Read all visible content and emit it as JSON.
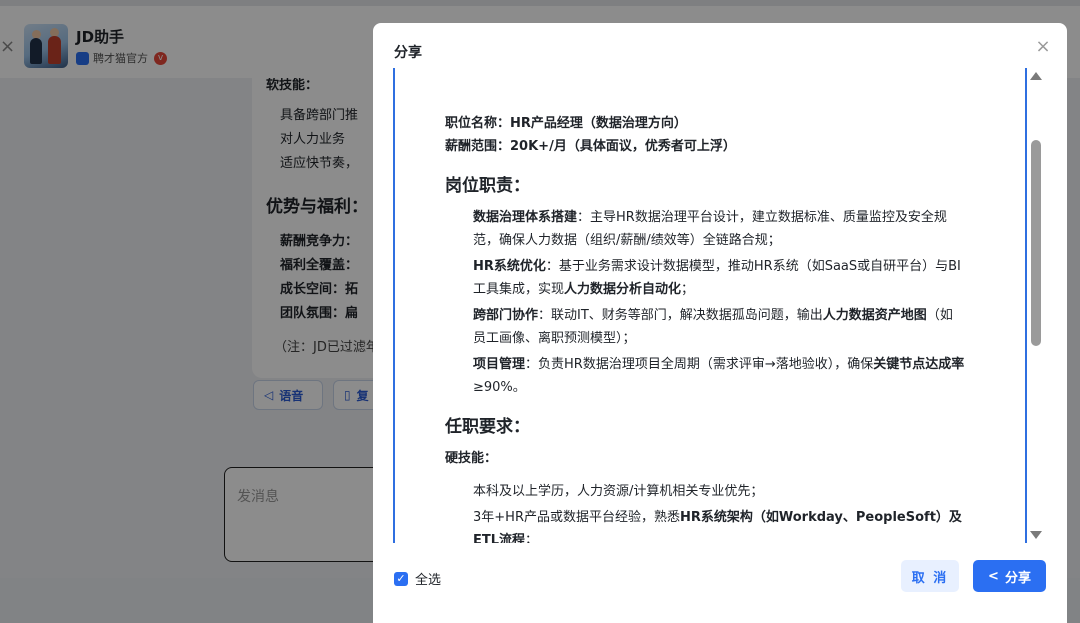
{
  "app": {
    "title": "JD助手",
    "subtitle": "聘才猫官方",
    "close_glyph": "×"
  },
  "background_chat": {
    "lines": [
      {
        "text": "软技能：",
        "style": "b"
      },
      {
        "text": "具备跨部门推",
        "style": ""
      },
      {
        "text": "对人力业务",
        "style": ""
      },
      {
        "text": "适应快节奏，",
        "style": ""
      },
      {
        "text": "优势与福利：",
        "style": "h"
      },
      {
        "text": "薪酬竞争力：",
        "style": "b"
      },
      {
        "text": "福利全覆盖：",
        "style": "b"
      },
      {
        "text": "成长空间：拓",
        "style": "b"
      },
      {
        "text": "团队氛围：扁",
        "style": "b"
      },
      {
        "text": "（注：JD已过滤年",
        "style": ""
      }
    ],
    "voice_button": "语音",
    "copy_button": "复",
    "input_placeholder": "发消息"
  },
  "modal": {
    "title": "分享",
    "close_glyph": "×",
    "content": {
      "position_line": {
        "label": "职位名称：",
        "value": "HR产品经理（数据治理方向）"
      },
      "salary_line": {
        "label": "薪酬范围：",
        "value": "20K+/月（具体面议，优秀者可上浮）"
      },
      "responsibilities_heading": "岗位职责：",
      "responsibilities": [
        {
          "key": "数据治理体系搭建",
          "text": "：主导HR数据治理平台设计，建立数据标准、质量监控及安全规范，确保人力数据（组织/薪酬/绩效等）全链路合规；",
          "bold_tail": "",
          "tail": ""
        },
        {
          "key": "HR系统优化",
          "text": "：基于业务需求设计数据模型，推动HR系统（如SaaS或自研平台）与BI工具集成，实现",
          "bold_tail": "人力数据分析自动化",
          "tail": "；"
        },
        {
          "key": "跨部门协作",
          "text": "：联动IT、财务等部门，解决数据孤岛问题，输出",
          "bold_tail": "人力数据资产地图",
          "tail": "（如员工画像、离职预测模型）；"
        },
        {
          "key": "项目管理",
          "text": "：负责HR数据治理项目全周期（需求评审→落地验收），确保",
          "bold_tail": "关键节点达成率",
          "tail": "≥90%。"
        }
      ],
      "requirements_heading": "任职要求：",
      "hard_skills_heading": "硬技能：",
      "hard_skills": [
        {
          "text": "本科及以上学历，人力资源/计算机相关专业优先；",
          "bold_tail": "",
          "tail": ""
        },
        {
          "text": "3年+HR产品或数据平台经验，熟悉",
          "bold_tail": "HR系统架构（如Workday、PeopleSoft）及ETL流程",
          "tail": "；"
        }
      ]
    },
    "select_all_label": "全选",
    "select_all_checked": true,
    "cancel_label": "取 消",
    "share_label": "分享"
  },
  "colors": {
    "accent": "#2b6ff2",
    "frame_border": "#2f6fe0"
  }
}
